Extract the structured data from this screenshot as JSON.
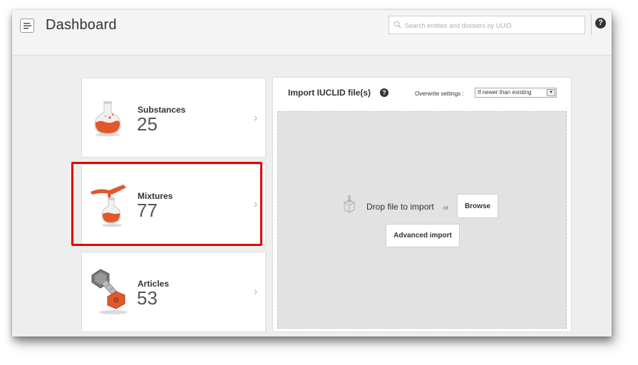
{
  "header": {
    "title": "Dashboard",
    "search_placeholder": "Search entities and dossiers by UUID",
    "help_glyph": "?"
  },
  "cards": [
    {
      "label": "Substances",
      "count": "25",
      "icon": "flask-icon"
    },
    {
      "label": "Mixtures",
      "count": "77",
      "icon": "pouring-flask-icon"
    },
    {
      "label": "Articles",
      "count": "53",
      "icon": "bolt-nut-icon"
    }
  ],
  "chevron": "›",
  "import_panel": {
    "title": "Import IUCLID file(s)",
    "help_glyph": "?",
    "overwrite_label": "Overwrite settings :",
    "overwrite_value": "If newer than existing",
    "drop_text": "Drop file to import",
    "or_text": "or",
    "browse_label": "Browse",
    "advanced_label": "Advanced import"
  },
  "colors": {
    "accent_orange": "#e2572b",
    "highlight_red": "#e00000"
  }
}
